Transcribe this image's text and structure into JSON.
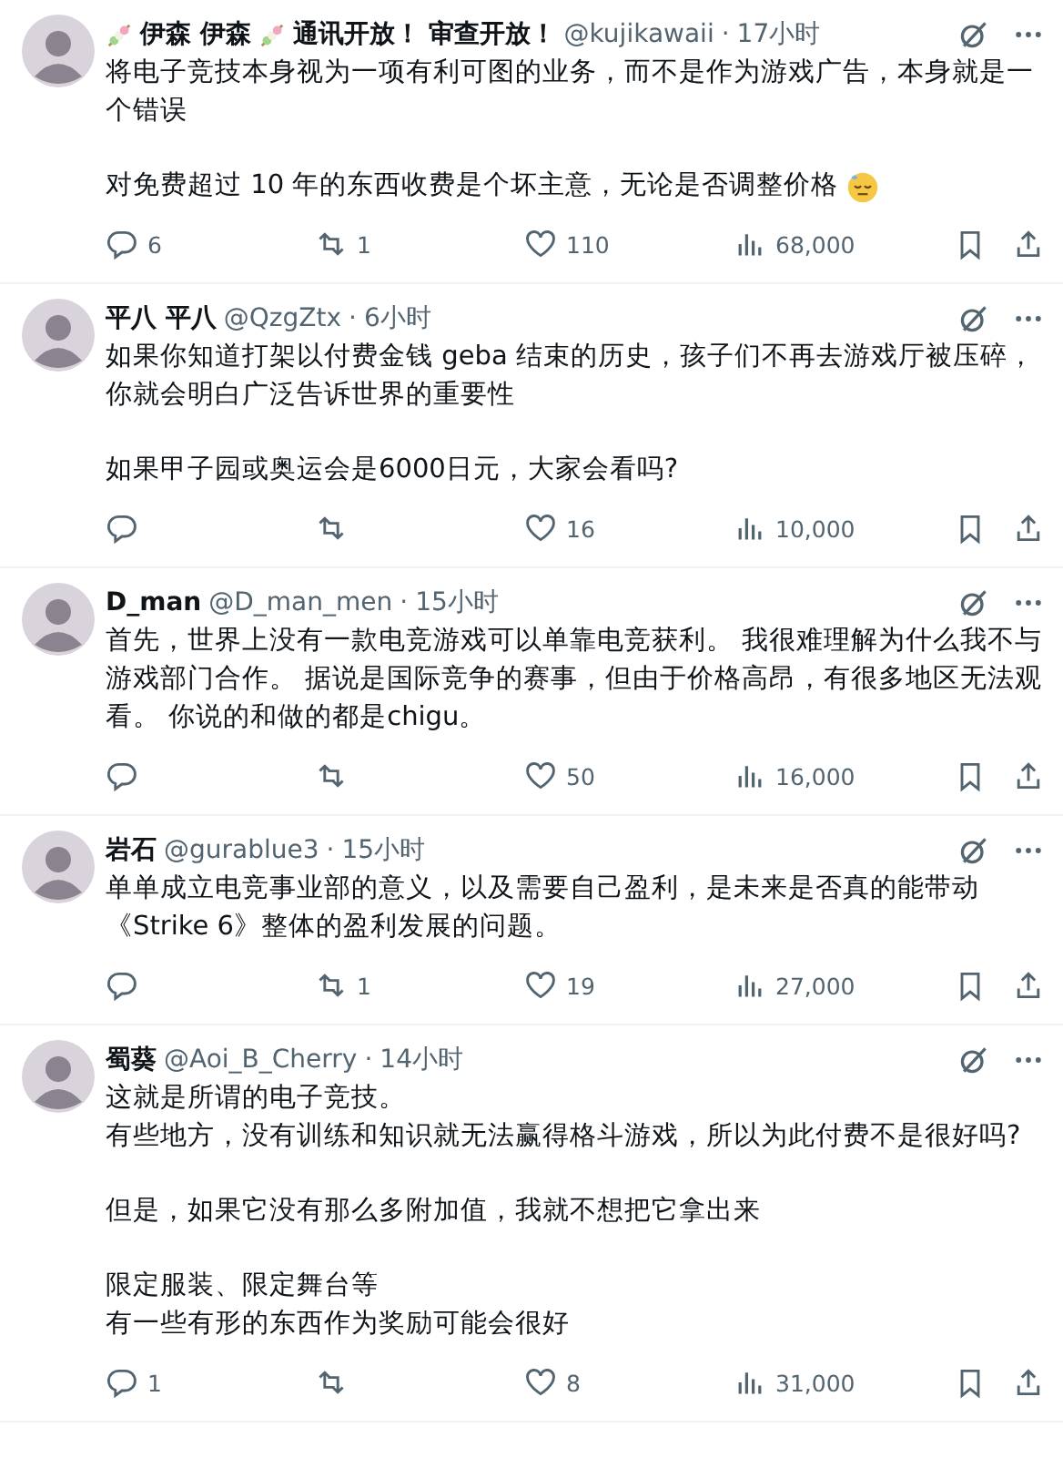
{
  "posts": [
    {
      "name_parts": [
        {
          "kind": "icon"
        },
        {
          "kind": "text",
          "text": "伊森 伊森"
        },
        {
          "kind": "icon"
        },
        {
          "kind": "text",
          "text": "通讯开放！ 审查开放！"
        }
      ],
      "handle": "@kujikawaii",
      "separator": "·",
      "time": "17小时",
      "paragraphs": [
        [
          "将电子竞技本身视为一项有利可图的业务，而不是作为游戏广告，本身就是一个错误"
        ],
        [
          "对免费超过 10 年的东西收费是个坏主意，无论是否调整价格"
        ]
      ],
      "trailing_emoji": true,
      "replies": "6",
      "reposts": "1",
      "likes": "110",
      "views": "68,000"
    },
    {
      "name_parts": [
        {
          "kind": "text",
          "text": "平八 平八"
        }
      ],
      "handle": "@QzgZtx",
      "separator": "·",
      "time": "6小时",
      "paragraphs": [
        [
          "如果你知道打架以付费金钱 geba 结束的历史，孩子们不再去游戏厅被压碎，你就会明白广泛告诉世界的重要性"
        ],
        [
          "如果甲子园或奥运会是6000日元，大家会看吗?"
        ]
      ],
      "trailing_emoji": false,
      "likes": "16",
      "views": "10,000"
    },
    {
      "name_parts": [
        {
          "kind": "text",
          "text": "D_man"
        }
      ],
      "handle": "@D_man_men",
      "separator": "·",
      "time": "15小时",
      "paragraphs": [
        [
          "首先，世界上没有一款电竞游戏可以单靠电竞获利。 我很难理解为什么我不与游戏部门合作。 据说是国际竞争的赛事，但由于价格高昂，有很多地区无法观看。 你说的和做的都是chigu。"
        ]
      ],
      "trailing_emoji": false,
      "likes": "50",
      "views": "16,000"
    },
    {
      "name_parts": [
        {
          "kind": "text",
          "text": "岩石"
        }
      ],
      "handle": "@gurablue3",
      "separator": "·",
      "time": "15小时",
      "paragraphs": [
        [
          "单单成立电竞事业部的意义，以及需要自己盈利，是未来是否真的能带动《Strike 6》整体的盈利发展的问题。"
        ]
      ],
      "trailing_emoji": false,
      "reposts": "1",
      "likes": "19",
      "views": "27,000"
    },
    {
      "name_parts": [
        {
          "kind": "text",
          "text": "蜀葵"
        }
      ],
      "handle": "@Aoi_B_Cherry",
      "separator": "·",
      "time": "14小时",
      "paragraphs": [
        [
          "这就是所谓的电子竞技。",
          "有些地方，没有训练和知识就无法赢得格斗游戏，所以为此付费不是很好吗?"
        ],
        [
          "但是，如果它没有那么多附加值，我就不想把它拿出来"
        ],
        [
          "限定服装、限定舞台等",
          "有一些有形的东西作为奖励可能会很好"
        ]
      ],
      "trailing_emoji": false,
      "replies": "1",
      "likes": "8",
      "views": "31,000"
    }
  ]
}
